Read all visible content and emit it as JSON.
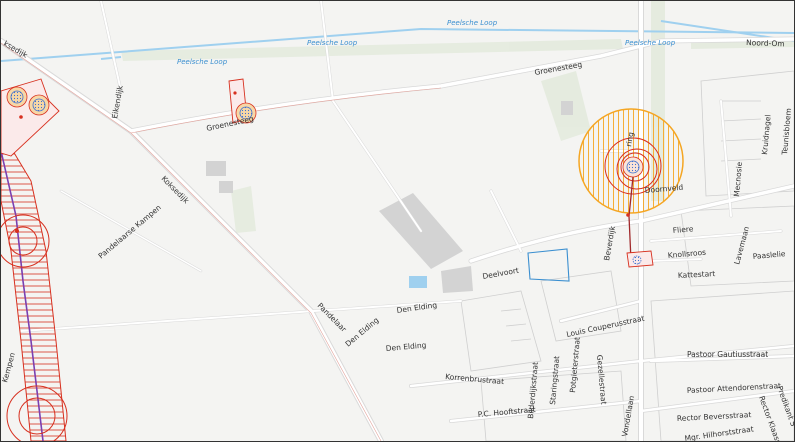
{
  "map": {
    "water_labels": [
      "Peelsche Loop",
      "Peelsche Loop",
      "Peelsche Loop",
      "Peelsche Loop"
    ],
    "street_labels": {
      "noord_om": "Noord-Om",
      "groenesteeg_1": "Groenesteeg",
      "groenesteeg_2": "Groenesteeg",
      "eikendijk": "Eikendijk",
      "koksedijk_top": "ksedijk",
      "koksedijk": "Koksedijk",
      "pandelaarse_kampen": "Pandelaarse Kampen",
      "pandelaar": "Pandelaar",
      "den_elding_1": "Den Elding",
      "den_elding_2": "Den Elding",
      "den_elding_3": "Den Elding",
      "deelvoort": "Deelvoort",
      "doornveld": "Doornveld",
      "ring": "ring",
      "beverdijk": "Beverdijk",
      "fliere": "Fliere",
      "knollsroos": "Knollsroos",
      "kattestart": "Kattestart",
      "lavemaan": "Lavemaan",
      "paaslelie": "Paaslelie",
      "kruidnagel": "Kruidnagel",
      "teunisbloem": "Teunisbloem",
      "mecnosie": "Mecnosie",
      "louis_couperusstraat": "Louis Couperusstraat",
      "pastoor_gautiusstraat": "Pastoor Gautiusstraat",
      "pastoor_attendorenstraat": "Pastoor Attendorenstraat",
      "rector_beversstraat": "Rector Beversstraat",
      "mgr_hilhorststraat": "Mgr. Hilhorststraat",
      "rector_klassenstraat": "Rector Klaasse...",
      "predikant": "Predikant S",
      "korrenbrustraat": "Korrenbrustraat",
      "bilderdijkstraat": "Bilderdijkstraat",
      "staringstraat": "Staringstraat",
      "potgieterstraat": "Potgieterstraat",
      "gezellestraat": "Gezellestraat",
      "pc_hooftstraat": "P.C. Hooftstraat",
      "vondellaan": "Vondellaan",
      "kempen": "Kempen"
    },
    "colors": {
      "background": "#f4f4f2",
      "road": "#ffffff",
      "road_outline": "#d9d9d9",
      "water": "#9fd0ef",
      "green": "#dfe8d8",
      "building": "#d3d3d3",
      "hazard_red": "#d7301f",
      "hazard_orange": "#f5a623",
      "site_blue": "#3b6fd0",
      "pipeline": "#7b3fb0",
      "plan_outline": "#3b8fd0"
    }
  }
}
